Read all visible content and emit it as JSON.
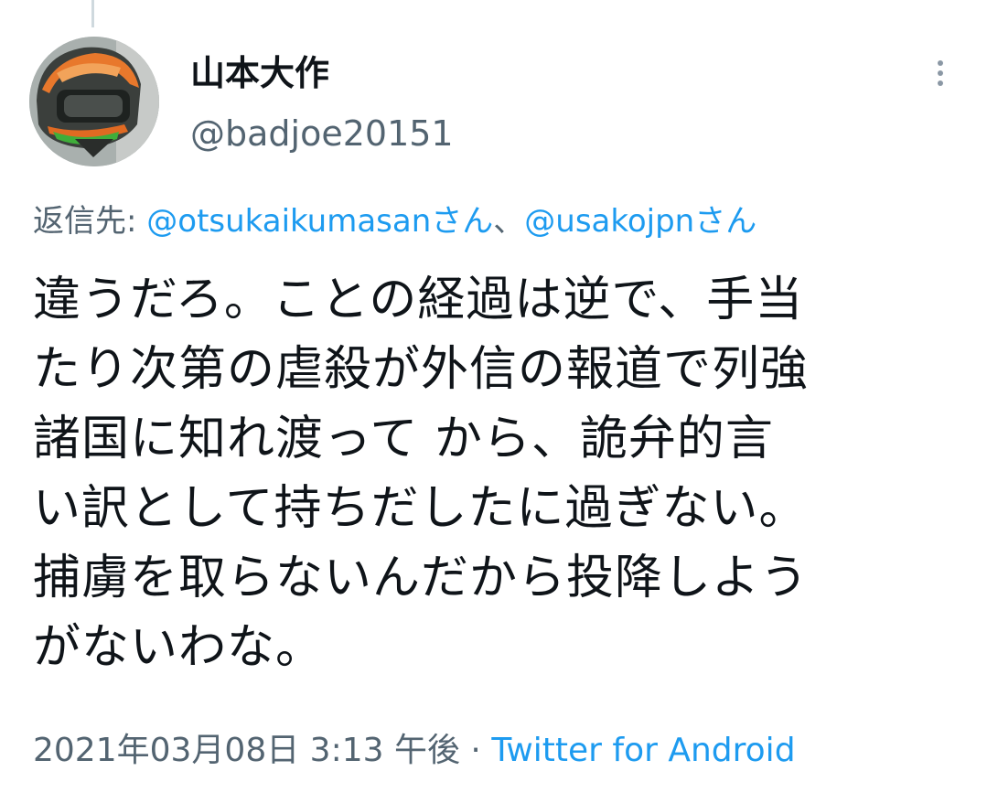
{
  "tweet": {
    "display_name": "山本大作",
    "handle": "@badjoe20151",
    "reply_prefix": "返信先: ",
    "reply_mentions": [
      "@otsukaikumasanさん",
      "@usakojpnさん"
    ],
    "reply_separator": "、",
    "text_lines": [
      "違うだろ。ことの経過は逆で、手当",
      "たり次第の虐殺が外信の報道で列強",
      "諸国に知れ渡って から、詭弁的言",
      "い訳として持ちだしたに過ぎない。",
      "捕虜を取らないんだから投降しよう",
      "がないわな。"
    ],
    "timestamp": "2021年03月08日 3:13 午後",
    "meta_separator": " · ",
    "source": "Twitter for Android"
  },
  "icons": {
    "avatar": "profile-photo-helmet",
    "more": "more-vertical-icon"
  },
  "colors": {
    "text_primary": "#0f1419",
    "text_secondary": "#536471",
    "link": "#1d9bf0",
    "divider": "#cfd9de"
  }
}
